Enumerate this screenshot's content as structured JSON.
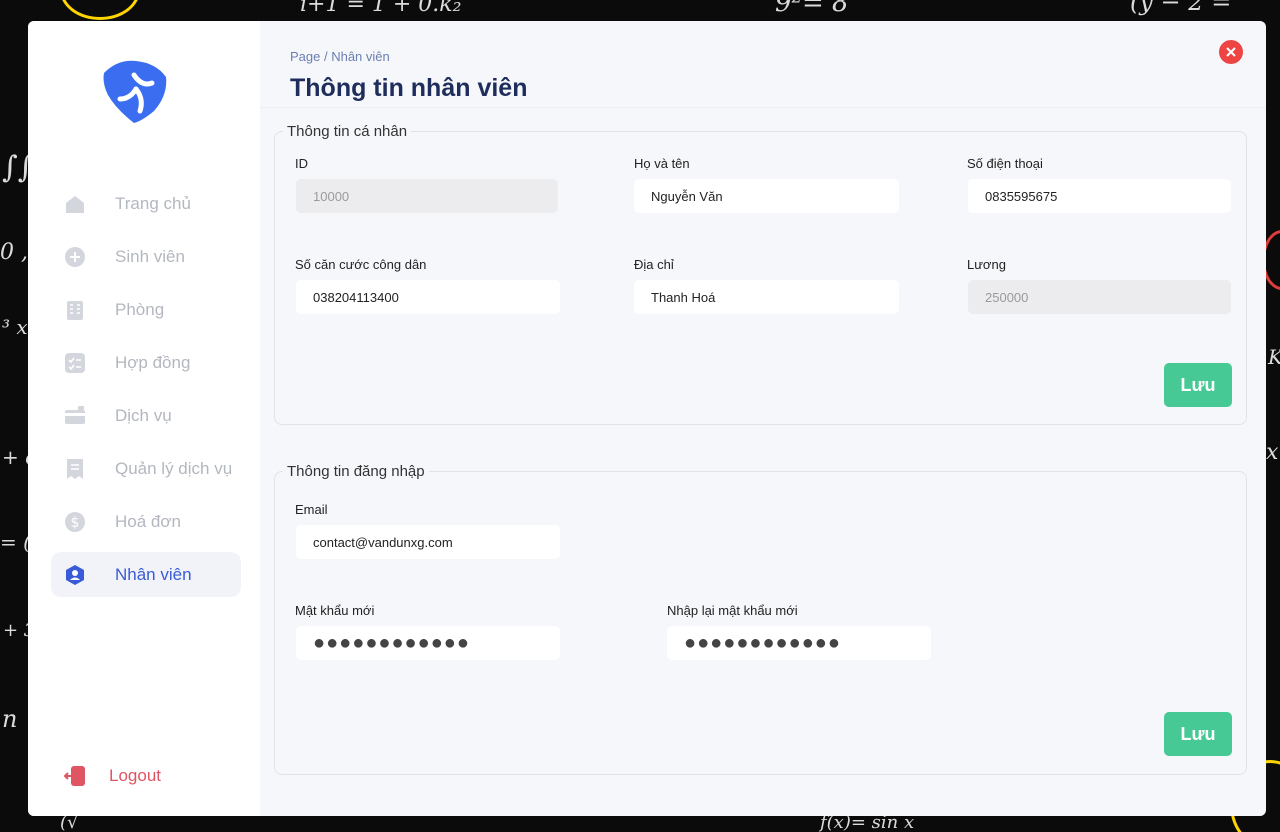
{
  "background": {
    "doodles": [
      "i+1 = 1 + 0.k₂",
      "9²= 8",
      "(y − 2 =",
      "∫∫",
      "0 ,",
      "³ x",
      "+ c",
      "= (",
      "+ 3",
      "n",
      "K",
      "f(x)= sin x",
      "(√",
      "x"
    ]
  },
  "sidebar": {
    "logo_icon": "brand-logo-icon",
    "items": [
      {
        "label": "Trang chủ",
        "icon": "home-icon",
        "active": false
      },
      {
        "label": "Sinh viên",
        "icon": "plus-circle-icon",
        "active": false
      },
      {
        "label": "Phòng",
        "icon": "building-icon",
        "active": false
      },
      {
        "label": "Hợp đồng",
        "icon": "checklist-icon",
        "active": false
      },
      {
        "label": "Dịch vụ",
        "icon": "card-icon",
        "active": false
      },
      {
        "label": "Quản lý dịch vụ",
        "icon": "receipt-icon",
        "active": false
      },
      {
        "label": "Hoá đơn",
        "icon": "dollar-icon",
        "active": false
      },
      {
        "label": "Nhân viên",
        "icon": "user-shield-icon",
        "active": true
      }
    ],
    "logout": {
      "label": "Logout",
      "icon": "logout-icon"
    }
  },
  "header": {
    "breadcrumb": "Page / Nhân viên",
    "title": "Thông tin nhân viên"
  },
  "personal": {
    "legend": "Thông tin cá nhân",
    "id": {
      "label": "ID",
      "value": "10000"
    },
    "name": {
      "label": "Họ và tên",
      "value": "Nguyễn Văn"
    },
    "phone": {
      "label": "Số điện thoại",
      "value": "0835595675"
    },
    "citizen_id": {
      "label": "Số căn cước công dân",
      "value": "038204113400"
    },
    "address": {
      "label": "Địa chỉ",
      "value": "Thanh Hoá"
    },
    "salary": {
      "label": "Lương",
      "value": "250000"
    },
    "save_label": "Lưu"
  },
  "login": {
    "legend": "Thông tin đăng nhập",
    "email": {
      "label": "Email",
      "value": "contact@vandunxg.com"
    },
    "new_password": {
      "label": "Mật khẩu mới",
      "value": "●●●●●●●●●●●●"
    },
    "confirm_password": {
      "label": "Nhập lại mật khẩu mới",
      "value": "●●●●●●●●●●●●"
    },
    "save_label": "Lưu"
  },
  "colors": {
    "accent": "#3a5bd9",
    "save": "#46c995",
    "close": "#ef4444",
    "logout": "#e05563"
  }
}
